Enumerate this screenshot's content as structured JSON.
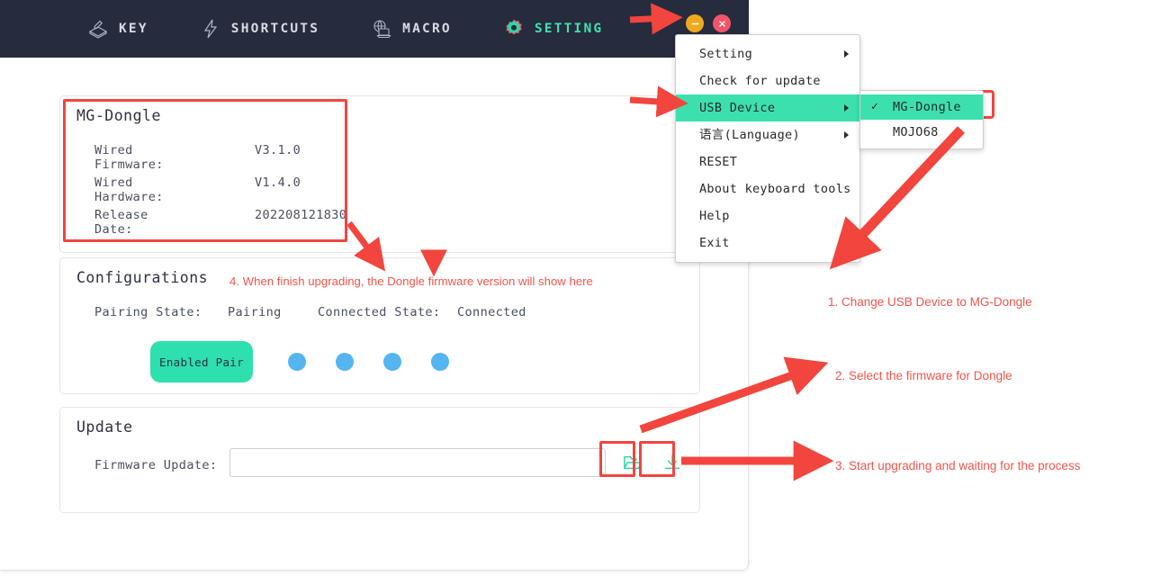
{
  "window": {
    "nav": [
      {
        "label": "KEY",
        "icon": "keycap-pen-icon",
        "active": false
      },
      {
        "label": "SHORTCUTS",
        "icon": "lightning-bolt-icon",
        "active": false
      },
      {
        "label": "MACRO",
        "icon": "globe-laptop-icon",
        "active": false
      },
      {
        "label": "SETTING",
        "icon": "gear-icon",
        "active": true
      }
    ],
    "controls": {
      "menu": "hamburger-menu-icon",
      "minimize": "minimize-icon",
      "close": "close-icon"
    }
  },
  "device_panel": {
    "title": "MG-Dongle",
    "rows": [
      {
        "label": "Wired Firmware:",
        "value": "V3.1.0"
      },
      {
        "label": "Wired Hardware:",
        "value": "V1.4.0"
      },
      {
        "label": "Release Date:",
        "value": "202208121830"
      }
    ]
  },
  "config_panel": {
    "title": "Configurations",
    "pairing_state_label": "Pairing State:",
    "pairing_state_value": "Pairing",
    "connected_state_label": "Connected State:",
    "connected_state_value": "Connected",
    "pair_button": "Enabled Pair",
    "slot_count": 4,
    "slot_color": "#55b5f0"
  },
  "update_panel": {
    "title": "Update",
    "firmware_label": "Firmware Update:",
    "firmware_value": "",
    "firmware_placeholder": "",
    "folder_icon": "folder-open-icon",
    "download_icon": "download-icon"
  },
  "menu": {
    "items": [
      {
        "label": "Setting",
        "submenu": true,
        "highlight": false
      },
      {
        "label": "Check for update",
        "submenu": false,
        "highlight": false
      },
      {
        "label": "USB Device",
        "submenu": true,
        "highlight": true
      },
      {
        "label": "语言(Language)",
        "submenu": true,
        "highlight": false
      },
      {
        "label": "RESET",
        "submenu": false,
        "highlight": false
      },
      {
        "label": "About keyboard tools",
        "submenu": false,
        "highlight": false
      },
      {
        "label": "Help",
        "submenu": false,
        "highlight": false
      },
      {
        "label": "Exit",
        "submenu": false,
        "highlight": false
      }
    ],
    "submenu": {
      "items": [
        {
          "label": "MG-Dongle",
          "checked": true,
          "highlight": true
        },
        {
          "label": "MOJO68",
          "checked": false,
          "highlight": false
        }
      ],
      "check_glyph": "✓"
    }
  },
  "annotations": {
    "step1": "1. Change USB Device to MG-Dongle",
    "step2": "2. Select the firmware for Dongle",
    "step3": "3. Start upgrading and waiting for the process",
    "step4": "4. When finish upgrading, the Dongle firmware version will show here"
  },
  "colors": {
    "accent_green": "#2de0ae",
    "annotation_red": "#f2554b",
    "titlebar": "#262b3d",
    "slot_blue": "#55b5f0"
  }
}
